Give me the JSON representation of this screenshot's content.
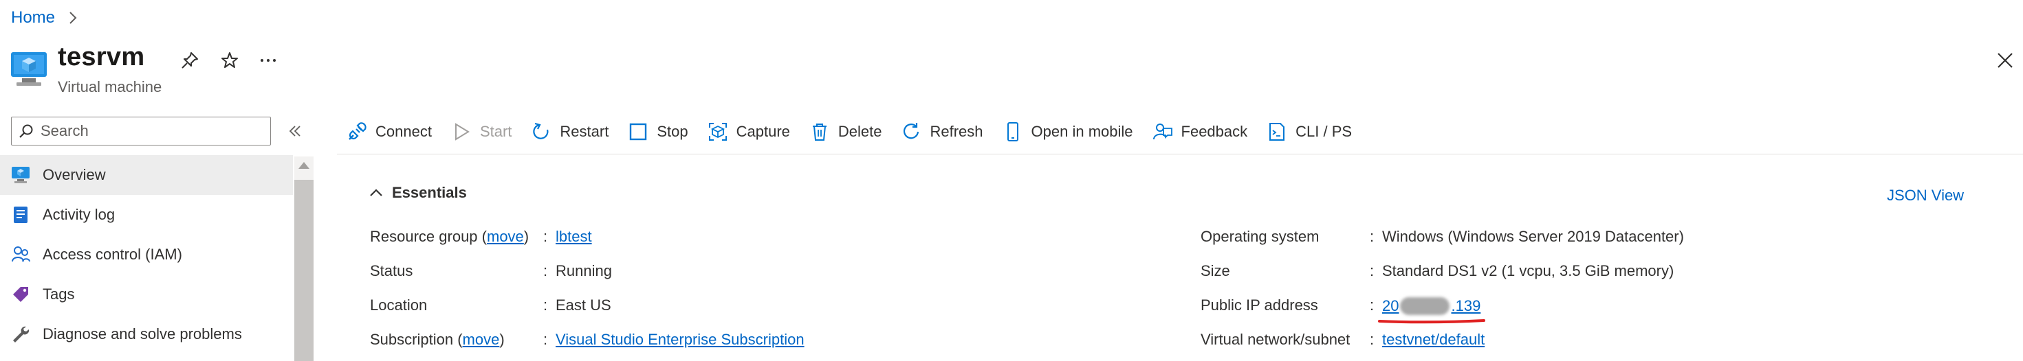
{
  "breadcrumb": {
    "home": "Home"
  },
  "header": {
    "title": "tesrvm",
    "subtitle": "Virtual machine",
    "icons": [
      "pin-icon",
      "star-icon",
      "more-icon",
      "close-icon"
    ]
  },
  "sidebar": {
    "search_placeholder": "Search",
    "items": [
      {
        "label": "Overview",
        "icon": "overview-icon",
        "active": true
      },
      {
        "label": "Activity log",
        "icon": "activity-log-icon"
      },
      {
        "label": "Access control (IAM)",
        "icon": "iam-icon"
      },
      {
        "label": "Tags",
        "icon": "tag-icon"
      },
      {
        "label": "Diagnose and solve problems",
        "icon": "wrench-icon"
      }
    ]
  },
  "toolbar": {
    "connect": "Connect",
    "start": "Start",
    "restart": "Restart",
    "stop": "Stop",
    "capture": "Capture",
    "delete": "Delete",
    "refresh": "Refresh",
    "open_mobile": "Open in mobile",
    "feedback": "Feedback",
    "cli": "CLI / PS"
  },
  "essentials": {
    "title": "Essentials",
    "json_view": "JSON View",
    "move": "move",
    "left": {
      "resource_group_label": "Resource group",
      "resource_group_value": "lbtest",
      "status_label": "Status",
      "status_value": "Running",
      "location_label": "Location",
      "location_value": "East US",
      "subscription_label": "Subscription",
      "subscription_value": "Visual Studio Enterprise Subscription"
    },
    "right": {
      "os_label": "Operating system",
      "os_value": "Windows (Windows Server 2019 Datacenter)",
      "size_label": "Size",
      "size_value": "Standard DS1 v2 (1 vcpu, 3.5 GiB memory)",
      "ip_label": "Public IP address",
      "ip_start": "20",
      "ip_end": ".139",
      "vnet_label": "Virtual network/subnet",
      "vnet_value": "testvnet/default"
    }
  },
  "colors": {
    "link": "#0066c6",
    "accent": "#0078d4",
    "annotation": "#e02020"
  }
}
